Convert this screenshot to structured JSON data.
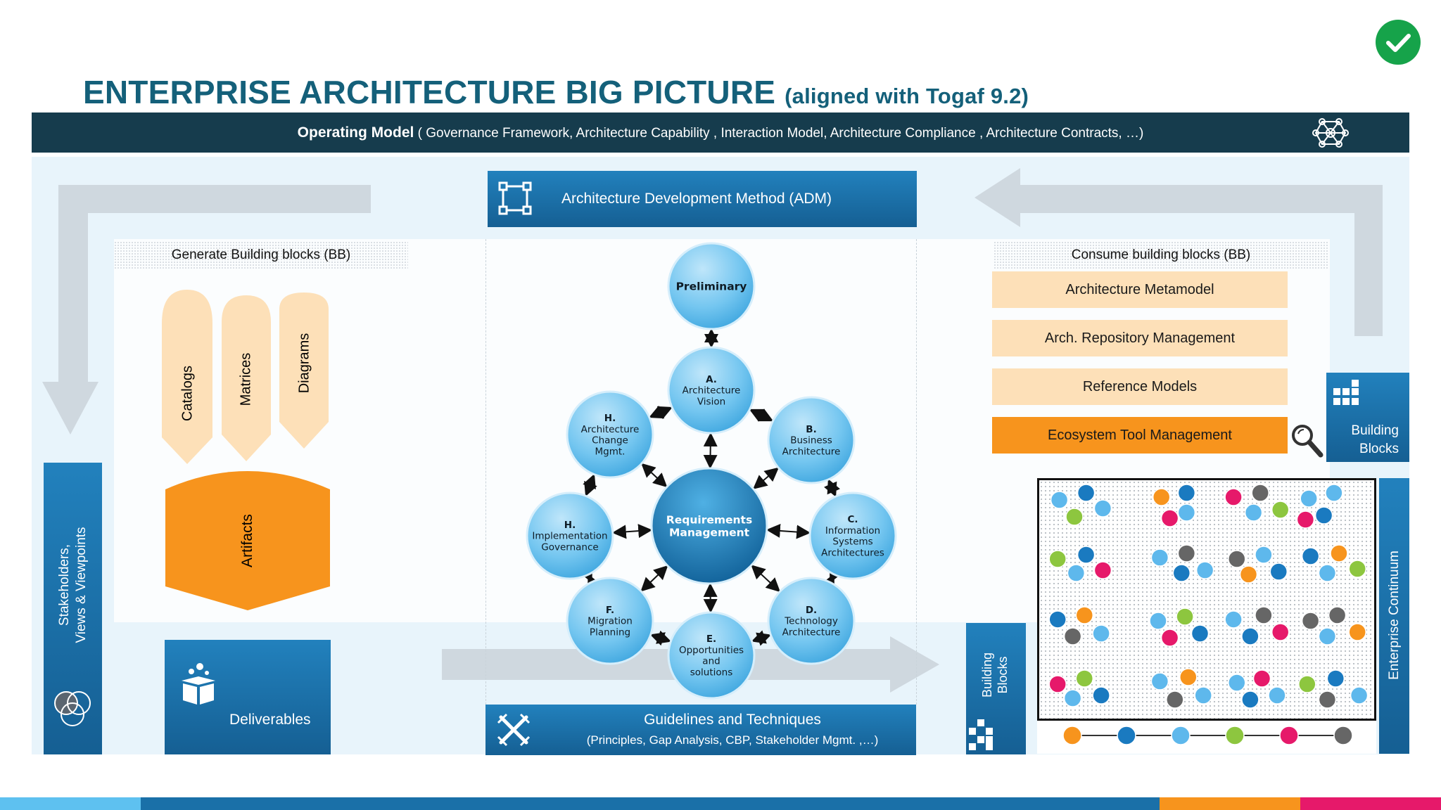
{
  "title": {
    "main": "ENTERPRISE ARCHITECTURE BIG PICTURE",
    "sub": "(aligned with Togaf 9.2)"
  },
  "operating_model": {
    "label": "Operating Model",
    "detail": "( Governance Framework, Architecture  Capability , Interaction Model, Architecture Compliance , Architecture Contracts, …)"
  },
  "adm": {
    "label": "Architecture Development Method (ADM)"
  },
  "generate_bb": {
    "label": "Generate Building blocks (BB)"
  },
  "consume_bb": {
    "label": "Consume building blocks (BB)",
    "items": [
      "Architecture Metamodel",
      "Arch. Repository Management",
      "Reference Models",
      "Ecosystem Tool Management"
    ]
  },
  "artifact_tabs": [
    "Catalogs",
    "Matrices",
    "Diagrams"
  ],
  "artifacts": {
    "label": "Artifacts"
  },
  "stakeholders": {
    "line1": "Stakeholders,",
    "line2": "Views & Viewpoints"
  },
  "deliverables": {
    "label": "Deliverables"
  },
  "guidelines": {
    "title": "Guidelines and Techniques",
    "subtitle": "(Principles, Gap Analysis, CBP, Stakeholder Mgmt. ,…)"
  },
  "building_blocks_right": {
    "line1": "Building",
    "line2": "Blocks"
  },
  "building_blocks_bottom": {
    "line1": "Building",
    "line2": "Blocks"
  },
  "enterprise_continuum": {
    "label": "Enterprise Continuum"
  },
  "adm_cycle": {
    "center": [
      "Requirements",
      "Management"
    ],
    "phases": [
      {
        "id": "preliminary",
        "lines": [
          "Preliminary"
        ]
      },
      {
        "id": "a",
        "lines": [
          "A.",
          "Architecture",
          "Vision"
        ]
      },
      {
        "id": "b",
        "lines": [
          "B.",
          "Business",
          "Architecture"
        ]
      },
      {
        "id": "c",
        "lines": [
          "C.",
          "Information",
          "Systems",
          "Architectures"
        ]
      },
      {
        "id": "d",
        "lines": [
          "D.",
          "Technology",
          "Architecture"
        ]
      },
      {
        "id": "e",
        "lines": [
          "E.",
          "Opportunities",
          "and",
          "solutions"
        ]
      },
      {
        "id": "f",
        "lines": [
          "F.",
          "Migration",
          "Planning"
        ]
      },
      {
        "id": "h-impl",
        "lines": [
          "H.",
          "Implementation",
          "Governance"
        ]
      },
      {
        "id": "h-change",
        "lines": [
          "H.",
          "Architecture",
          "Change",
          "Mgmt."
        ]
      }
    ]
  },
  "colors": {
    "title": "#14607a",
    "dark_bar": "#163c4d",
    "blue": "#1a70a8",
    "orange": "#f7941d",
    "peach": "#fde0b8",
    "check_green": "#16a34a",
    "dot_colors": [
      "#f7941d",
      "#1a7ac0",
      "#5eb8ec",
      "#8dc63f",
      "#e6196a",
      "#666666"
    ]
  },
  "icons": {
    "check": "check-circle-icon",
    "network": "network-icon",
    "adm": "workflow-icon",
    "magnifier": "magnifier-icon",
    "deliverables": "box-icon",
    "stakeholders": "venn-icon",
    "guidelines": "tools-icon",
    "building_blocks": "blocks-icon"
  }
}
